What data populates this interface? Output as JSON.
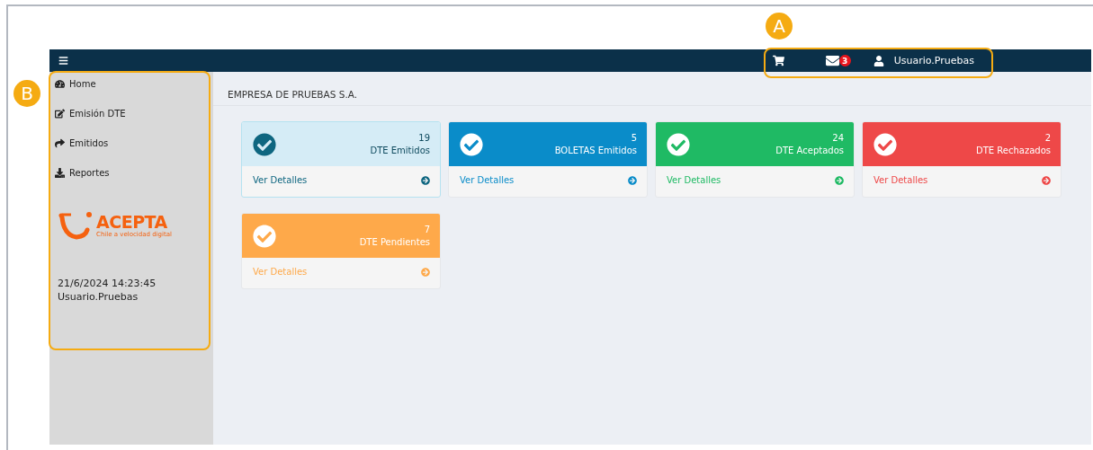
{
  "annotations": [
    {
      "label": "A"
    },
    {
      "label": "B"
    }
  ],
  "topbar": {
    "mail_count": "3",
    "user": "Usuario.Pruebas"
  },
  "sidebar": {
    "items": [
      {
        "label": "Home"
      },
      {
        "label": "Emisión DTE"
      },
      {
        "label": "Emitidos"
      },
      {
        "label": "Reportes"
      }
    ],
    "logo": {
      "name": "ACEPTA",
      "tagline": "Chile a velocidad digital"
    },
    "datetime": "21/6/2024 14:23:45",
    "user": "Usuario.Pruebas"
  },
  "page_title": "EMPRESA DE PRUEBAS S.A.",
  "cards": [
    {
      "kind": "light",
      "color": "#0e6680",
      "count": "19",
      "label": "DTE Emitidos",
      "link": "Ver Detalles"
    },
    {
      "kind": "solid",
      "color": "#0a8cc9",
      "count": "5",
      "label": "BOLETAS Emitidos",
      "link": "Ver Detalles"
    },
    {
      "kind": "solid",
      "color": "#1fba64",
      "count": "24",
      "label": "DTE Aceptados",
      "link": "Ver Detalles"
    },
    {
      "kind": "solid",
      "color": "#ee4848",
      "count": "2",
      "label": "DTE Rechazados",
      "link": "Ver Detalles"
    },
    {
      "kind": "solid",
      "color": "#fea94a",
      "count": "7",
      "label": "DTE Pendientes",
      "link": "Ver Detalles"
    }
  ]
}
